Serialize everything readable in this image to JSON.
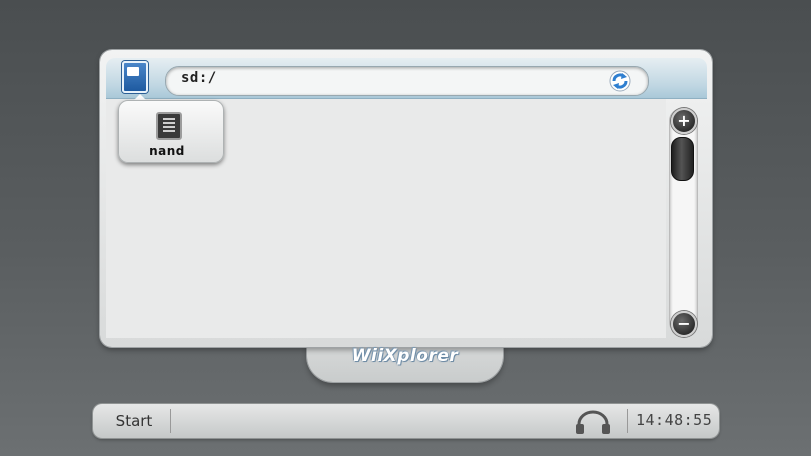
{
  "explorer": {
    "path": "sd:/",
    "drive_popup": {
      "item_label": "nand"
    }
  },
  "scrollbar": {
    "up_symbol": "+",
    "down_symbol": "−"
  },
  "branding": {
    "logo_text": "WiiXplorer"
  },
  "statusbar": {
    "start_label": "Start",
    "clock": "14:48:55"
  },
  "icons": {
    "drive": "sd-card-icon",
    "nand": "chip-icon",
    "refresh": "refresh-icon",
    "music": "headphones-icon"
  },
  "colors": {
    "header_accent": "#bfd6e2",
    "drive_blue": "#1e5aa0",
    "refresh_blue": "#2f7fd0"
  }
}
